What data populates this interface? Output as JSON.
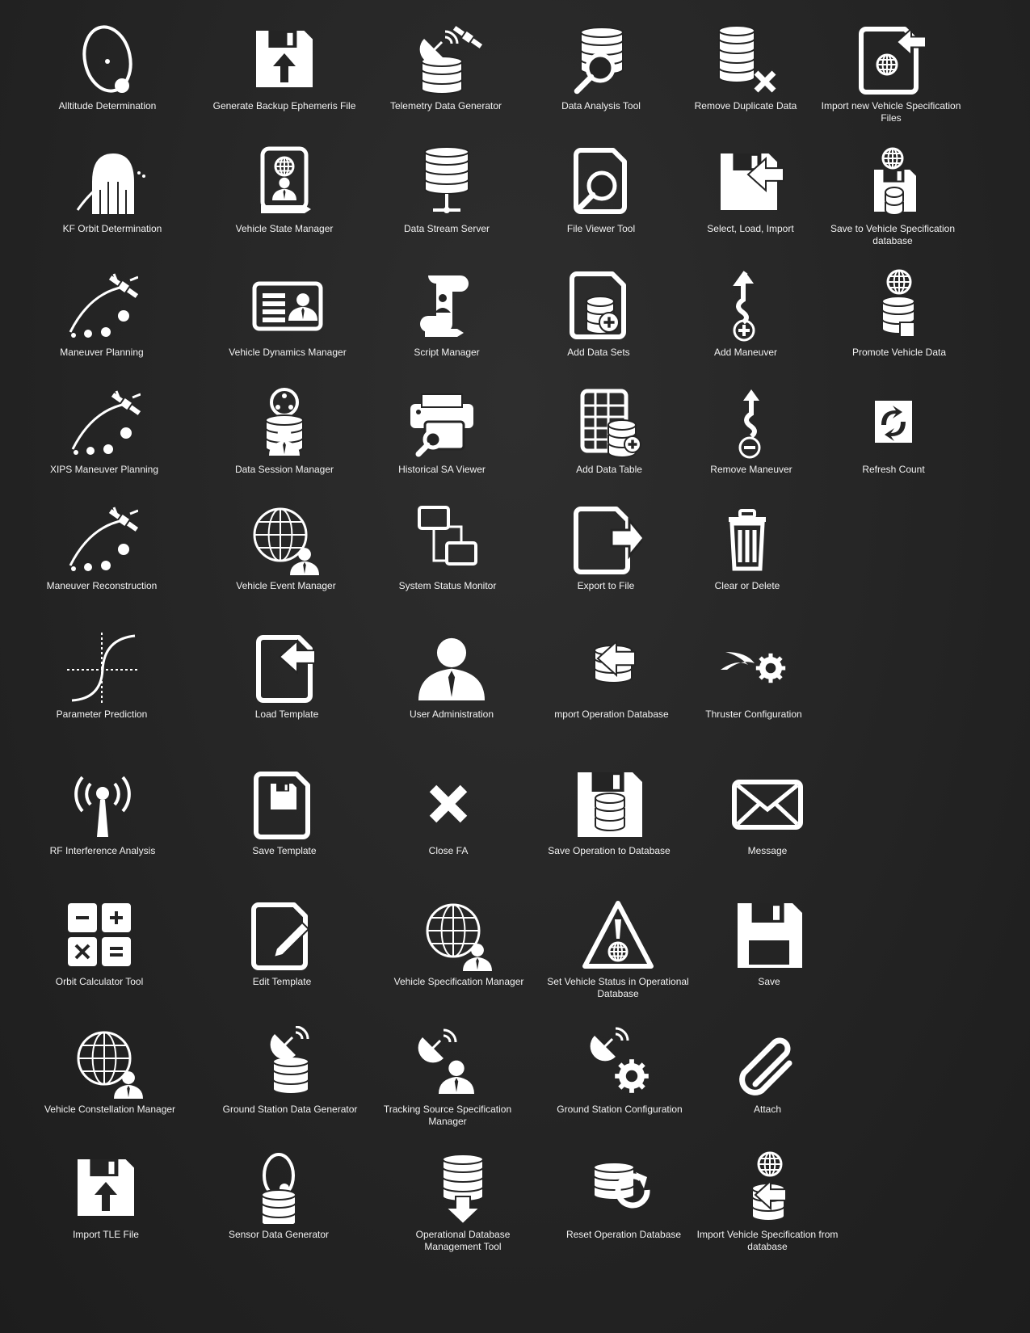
{
  "colors": {
    "background": "#242424",
    "icon": "#ffffff",
    "text": "#f2f2f2"
  },
  "icons": [
    [
      {
        "label": "Alltitude Determination",
        "icon": "orbit-ellipse-icon"
      },
      {
        "label": "Generate Backup Ephemeris File",
        "icon": "floppy-upload-icon"
      },
      {
        "label": "Telemetry Data Generator",
        "icon": "satellite-database-icon"
      },
      {
        "label": "Data Analysis Tool",
        "icon": "database-magnifier-icon"
      },
      {
        "label": "Remove Duplicate Data",
        "icon": "database-remove-icon"
      },
      {
        "label": "Import new Vehicle Specification Files",
        "icon": "file-globe-import-icon"
      }
    ],
    [
      {
        "label": "KF Orbit Determination",
        "icon": "bell-curve-orbit-icon"
      },
      {
        "label": "Vehicle State Manager",
        "icon": "document-globe-user-icon"
      },
      {
        "label": "Data Stream Server",
        "icon": "database-server-icon"
      },
      {
        "label": "File Viewer Tool",
        "icon": "file-magnifier-icon"
      },
      {
        "label": "Select, Load, Import",
        "icon": "floppy-import-icon"
      },
      {
        "label": "Save to Vehicle Specification database",
        "icon": "globe-floppy-database-icon"
      }
    ],
    [
      {
        "label": "Maneuver Planning",
        "icon": "satellite-trajectory-icon"
      },
      {
        "label": "Vehicle Dynamics Manager",
        "icon": "id-card-icon"
      },
      {
        "label": "Script Manager",
        "icon": "script-scroll-icon"
      },
      {
        "label": "Add Data Sets",
        "icon": "file-database-add-icon"
      },
      {
        "label": "Add Maneuver",
        "icon": "path-add-icon"
      },
      {
        "label": "Promote Vehicle Data",
        "icon": "globe-database-thumbs-up-icon"
      }
    ],
    [
      {
        "label": "XIPS Maneuver Planning",
        "icon": "satellite-trajectory-icon"
      },
      {
        "label": "Data Session Manager",
        "icon": "database-user-network-icon"
      },
      {
        "label": "Historical SA Viewer",
        "icon": "printer-magnifier-icon"
      },
      {
        "label": "Add Data Table",
        "icon": "table-database-add-icon"
      },
      {
        "label": "Remove Maneuver",
        "icon": "path-remove-icon"
      },
      {
        "label": "Refresh Count",
        "icon": "refresh-arrows-icon"
      }
    ],
    [
      {
        "label": "Maneuver Reconstruction",
        "icon": "satellite-trajectory-icon"
      },
      {
        "label": "Vehicle Event Manager",
        "icon": "globe-user-icon"
      },
      {
        "label": "System Status Monitor",
        "icon": "monitors-network-icon"
      },
      {
        "label": "Export to File",
        "icon": "file-export-icon"
      },
      {
        "label": "Clear or Delete",
        "icon": "trash-icon"
      }
    ],
    [
      {
        "label": "Parameter Prediction",
        "icon": "s-curve-graph-icon"
      },
      {
        "label": "Load Template",
        "icon": "file-import-icon"
      },
      {
        "label": "User Administration",
        "icon": "user-icon"
      },
      {
        "label": "mport Operation Database",
        "icon": "database-import-icon"
      },
      {
        "label": "Thruster Configuration",
        "icon": "thruster-gear-icon"
      }
    ],
    [
      {
        "label": "RF Interference Analysis",
        "icon": "radio-tower-icon"
      },
      {
        "label": "Save Template",
        "icon": "file-floppy-icon"
      },
      {
        "label": "Close FA",
        "icon": "close-icon"
      },
      {
        "label": "Save Operation to Database",
        "icon": "floppy-database-icon"
      },
      {
        "label": "Message",
        "icon": "envelope-icon"
      }
    ],
    [
      {
        "label": "Orbit Calculator Tool",
        "icon": "calculator-icon"
      },
      {
        "label": "Edit Template",
        "icon": "file-pencil-icon"
      },
      {
        "label": "Vehicle Specification Manager",
        "icon": "globe-user-icon"
      },
      {
        "label": "Set Vehicle Status in Operational Database",
        "icon": "warning-globe-icon"
      },
      {
        "label": "Save",
        "icon": "floppy-icon"
      }
    ],
    [
      {
        "label": "Vehicle Constellation Manager",
        "icon": "globe-user-icon"
      },
      {
        "label": "Ground Station Data Generator",
        "icon": "satellite-dish-database-icon"
      },
      {
        "label": "Tracking Source Specification Manager",
        "icon": "satellite-dish-user-icon"
      },
      {
        "label": "Ground Station Configuration",
        "icon": "satellite-dish-gear-icon"
      },
      {
        "label": "Attach",
        "icon": "paperclip-icon"
      }
    ],
    [
      {
        "label": "Import TLE File",
        "icon": "floppy-upload-icon"
      },
      {
        "label": "Sensor Data Generator",
        "icon": "orbit-database-icon"
      },
      {
        "label": "Operational Database Management Tool",
        "icon": "database-down-arrow-icon"
      },
      {
        "label": "Reset Operation Database",
        "icon": "database-refresh-icon"
      },
      {
        "label": "Import Vehicle Specification from database",
        "icon": "globe-database-import-icon"
      }
    ]
  ]
}
